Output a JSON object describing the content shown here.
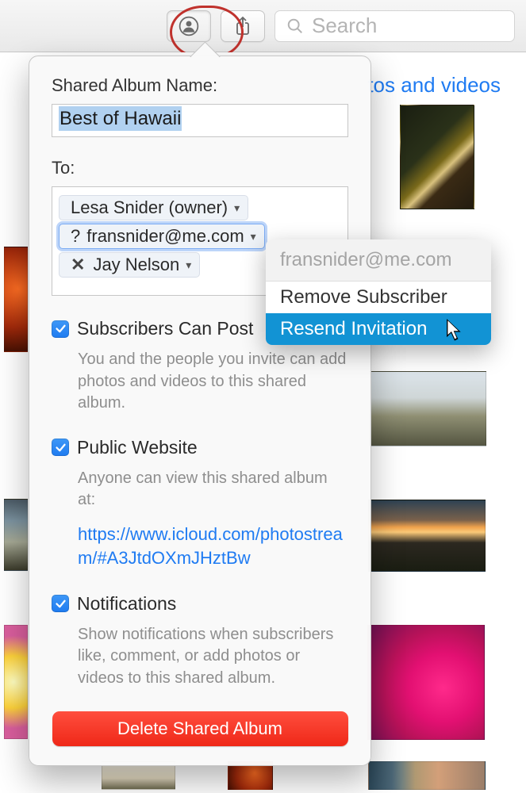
{
  "toolbar": {
    "search_placeholder": "Search"
  },
  "header": {
    "link_text": "tos and videos"
  },
  "popover": {
    "album_name_label": "Shared Album Name:",
    "album_name_value": "Best of Hawaii",
    "to_label": "To:",
    "recipients": [
      {
        "label": "Lesa Snider (owner)",
        "prefix": "",
        "removable": false
      },
      {
        "label": "fransnider@me.com",
        "prefix": "? ",
        "removable": false
      },
      {
        "label": "Jay Nelson",
        "prefix": "✕ ",
        "removable": true
      }
    ],
    "subscribers": {
      "label": "Subscribers Can Post",
      "help": "You and the people you invite can add photos and videos to this shared album.",
      "checked": true
    },
    "public": {
      "label": "Public Website",
      "help": "Anyone can view this shared album at:",
      "url": "https://www.icloud.com/photostream/#A3JtdOXmJHztBw",
      "checked": true
    },
    "notifications": {
      "label": "Notifications",
      "help": "Show notifications when subscribers like, comment, or add photos or videos to this shared album.",
      "checked": true
    },
    "delete_label": "Delete Shared Album"
  },
  "context_menu": {
    "header": "fransnider@me.com",
    "items": [
      {
        "label": "Remove Subscriber",
        "selected": false
      },
      {
        "label": "Resend Invitation",
        "selected": true
      }
    ]
  }
}
